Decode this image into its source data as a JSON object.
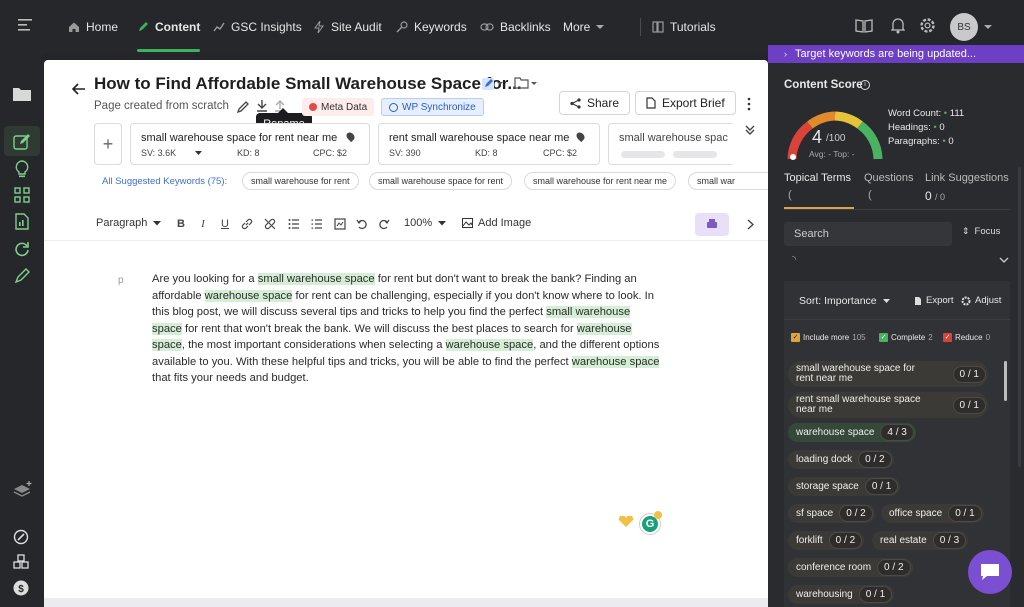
{
  "nav": {
    "items": [
      {
        "label": "Home",
        "icon": "home-icon"
      },
      {
        "label": "Content",
        "icon": "pencil-icon",
        "active": true
      },
      {
        "label": "GSC Insights",
        "icon": "chart-icon"
      },
      {
        "label": "Site Audit",
        "icon": "bolt-icon"
      },
      {
        "label": "Keywords",
        "icon": "key-icon"
      },
      {
        "label": "Backlinks",
        "icon": "link-icon"
      },
      {
        "label": "More",
        "icon": "chevron-down-icon"
      },
      {
        "label": "Tutorials",
        "icon": "book-icon"
      }
    ],
    "avatar": "BS",
    "accent": "#3cb25f"
  },
  "doc": {
    "title": "How to Find Affordable Small Warehouse Space for...",
    "subtitle": "Page created from scratch",
    "meta_data": "Meta Data",
    "wp_sync": "WP Synchronize",
    "share": "Share",
    "export_brief": "Export Brief",
    "tooltip": "Rename"
  },
  "keywords": [
    {
      "kw": "small warehouse space for rent near me",
      "sv": "SV: 3.6K",
      "kd": "KD: 8",
      "cpc": "CPC: $2"
    },
    {
      "kw": "rent small warehouse space near me",
      "sv": "SV: 390",
      "kd": "KD: 8",
      "cpc": "CPC: $2"
    },
    {
      "kw": "small warehouse spac"
    }
  ],
  "suggested": {
    "label": "All Suggested Keywords (75):",
    "chips": [
      "small warehouse for rent",
      "small warehouse space for rent",
      "small warehouse for rent near me",
      "small war"
    ]
  },
  "toolbar": {
    "paragraph": "Paragraph",
    "zoom": "100%",
    "add_image": "Add Image"
  },
  "body": {
    "marker": "p"
  },
  "right": {
    "banner": "Target keywords are being updated...",
    "content_score": "Content Score",
    "score": "4",
    "score_max": "/100",
    "avg": "Avg: -  Top: -",
    "word_count": "Word Count:",
    "word_count_v": "111",
    "headings": "Headings:",
    "headings_v": "0",
    "paragraphs": "Paragraphs:",
    "paragraphs_v": "0",
    "tabs": [
      "Topical Terms",
      "Questions",
      "Link Suggestions"
    ],
    "link_count": "0",
    "link_total": "/ 0",
    "search": "Search",
    "focus": "Focus",
    "sort": "Sort: Importance",
    "export": "Export",
    "adjust": "Adjust",
    "include_more": "Include more",
    "include_more_n": "105",
    "complete": "Complete",
    "complete_n": "2",
    "reduce": "Reduce",
    "reduce_n": "0",
    "terms": [
      {
        "label": "small warehouse space for rent near me",
        "count": "0 / 1"
      },
      {
        "label": "rent small warehouse space near me",
        "count": "0 / 1"
      },
      {
        "label": "warehouse space",
        "count": "4 / 3"
      },
      {
        "label": "loading dock",
        "count": "0 / 2"
      },
      {
        "label": "storage space",
        "count": "0 / 1"
      },
      {
        "label": "sf space",
        "count": "0 / 2"
      },
      {
        "label": "office space",
        "count": "0 / 1"
      },
      {
        "label": "forklift",
        "count": "0 / 2"
      },
      {
        "label": "real estate",
        "count": "0 / 3"
      },
      {
        "label": "conference room",
        "count": "0 / 2"
      },
      {
        "label": "warehousing",
        "count": "0 / 1"
      }
    ]
  }
}
